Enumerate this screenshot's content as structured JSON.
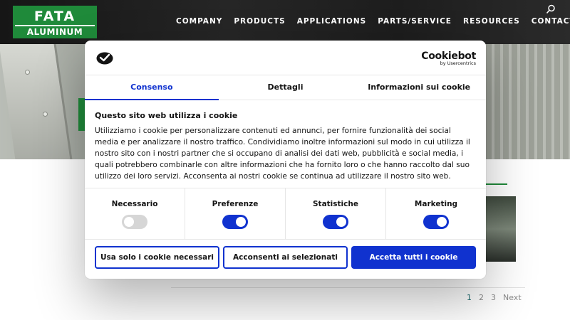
{
  "header": {
    "logo": {
      "line1": "FATA",
      "line2": "ALUMINUM"
    },
    "nav": [
      "COMPANY",
      "PRODUCTS",
      "APPLICATIONS",
      "PARTS/SERVICE",
      "RESOURCES",
      "CONTACT US"
    ],
    "search_icon": "search-icon"
  },
  "pagination": {
    "pages": [
      "1",
      "2",
      "3"
    ],
    "next": "Next",
    "active": "1"
  },
  "cookie_dialog": {
    "brand": {
      "name": "Cookiebot",
      "by": "by Usercentrics"
    },
    "tabs": [
      {
        "label": "Consenso",
        "active": true
      },
      {
        "label": "Dettagli",
        "active": false
      },
      {
        "label": "Informazioni sui cookie",
        "active": false
      }
    ],
    "title": "Questo sito web utilizza i cookie",
    "description": "Utilizziamo i cookie per personalizzare contenuti ed annunci, per fornire funzionalità dei social media e per analizzare il nostro traffico. Condividiamo inoltre informazioni sul modo in cui utilizza il nostro sito con i nostri partner che si occupano di analisi dei dati web, pubblicità e social media, i quali potrebbero combinarle con altre informazioni che ha fornito loro o che hanno raccolto dal suo utilizzo dei loro servizi. Acconsenta ai nostri cookie se continua ad utilizzare il nostro sito web.",
    "categories": [
      {
        "label": "Necessario",
        "enabled": false
      },
      {
        "label": "Preferenze",
        "enabled": true
      },
      {
        "label": "Statistiche",
        "enabled": true
      },
      {
        "label": "Marketing",
        "enabled": true
      }
    ],
    "buttons": {
      "necessary_only": "Usa solo i cookie necessari",
      "allow_selected": "Acconsenti ai selezionati",
      "allow_all": "Accetta tutti i cookie"
    }
  },
  "colors": {
    "accent": "#1032cf",
    "brand_green": "#1f8a3a",
    "header_bg": "#1b1b1b"
  }
}
